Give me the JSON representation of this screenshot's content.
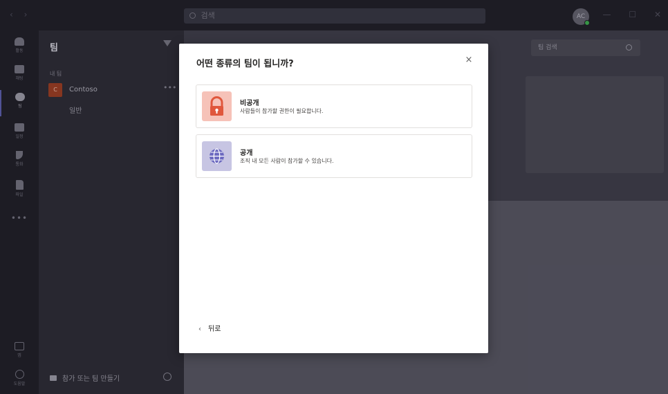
{
  "titlebar": {
    "search_placeholder": "검색",
    "avatar_initials": "AC"
  },
  "rail": {
    "items": [
      {
        "label": "활동",
        "icon": "bell-icon"
      },
      {
        "label": "채팅",
        "icon": "chat-icon"
      },
      {
        "label": "팀",
        "icon": "teams-icon"
      },
      {
        "label": "일정",
        "icon": "calendar-icon"
      },
      {
        "label": "통화",
        "icon": "phone-icon"
      },
      {
        "label": "파일",
        "icon": "file-icon"
      }
    ],
    "more": "•••",
    "apps_label": "앱",
    "help_label": "도움말"
  },
  "panel": {
    "title": "팀",
    "section_label": "내 팀",
    "team_name": "Contoso",
    "team_initial": "C",
    "channel": "일반",
    "more": "•••",
    "join_label": "참가 또는 팀 만들기"
  },
  "main": {
    "team_search_placeholder": "팀 검색"
  },
  "modal": {
    "title": "어떤 종류의 팀이 됩니까?",
    "close": "×",
    "options": [
      {
        "title": "비공개",
        "description": "사람들이 참가할 권한이 필요합니다.",
        "icon": "lock-icon",
        "color": "#f6c2b8"
      },
      {
        "title": "공개",
        "description": "조직 내 모든 사람이 참가할 수 있습니다.",
        "icon": "globe-icon",
        "color": "#c7c5e3"
      }
    ],
    "back_label": "뒤로",
    "back_chevron": "‹"
  },
  "colors": {
    "accent": "#5558a0",
    "lock_red": "#e0573c",
    "globe_purple": "#6b69c0"
  }
}
